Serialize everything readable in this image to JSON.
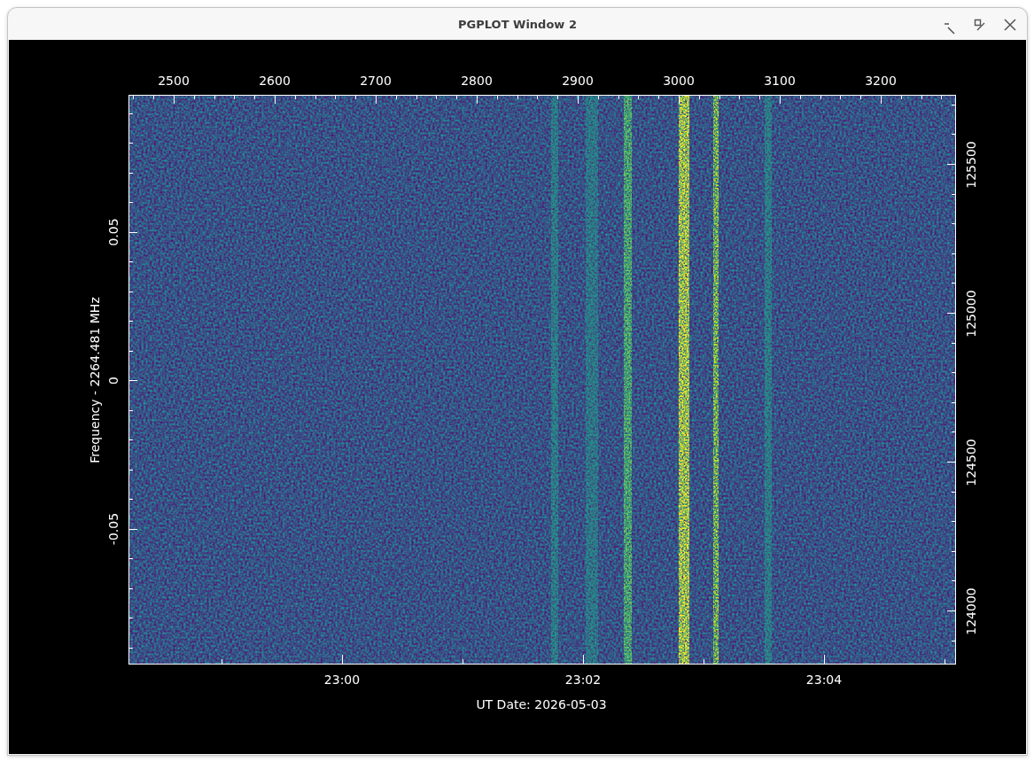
{
  "window": {
    "title": "PGPLOT Window 2"
  },
  "plot": {
    "top_axis": {
      "tick_labels": [
        "2500",
        "2600",
        "2700",
        "2800",
        "2900",
        "3000",
        "3100",
        "3200"
      ]
    },
    "left_axis": {
      "title": "Frequency - 2264.481 MHz",
      "tick_labels": [
        "0.05",
        "0",
        "-0.05"
      ]
    },
    "right_axis": {
      "tick_labels": [
        "125500",
        "125000",
        "124500",
        "124000"
      ]
    },
    "bottom_axis": {
      "title": "UT Date: 2026-05-03",
      "tick_labels": [
        "23:00",
        "23:02",
        "23:04"
      ]
    }
  }
}
